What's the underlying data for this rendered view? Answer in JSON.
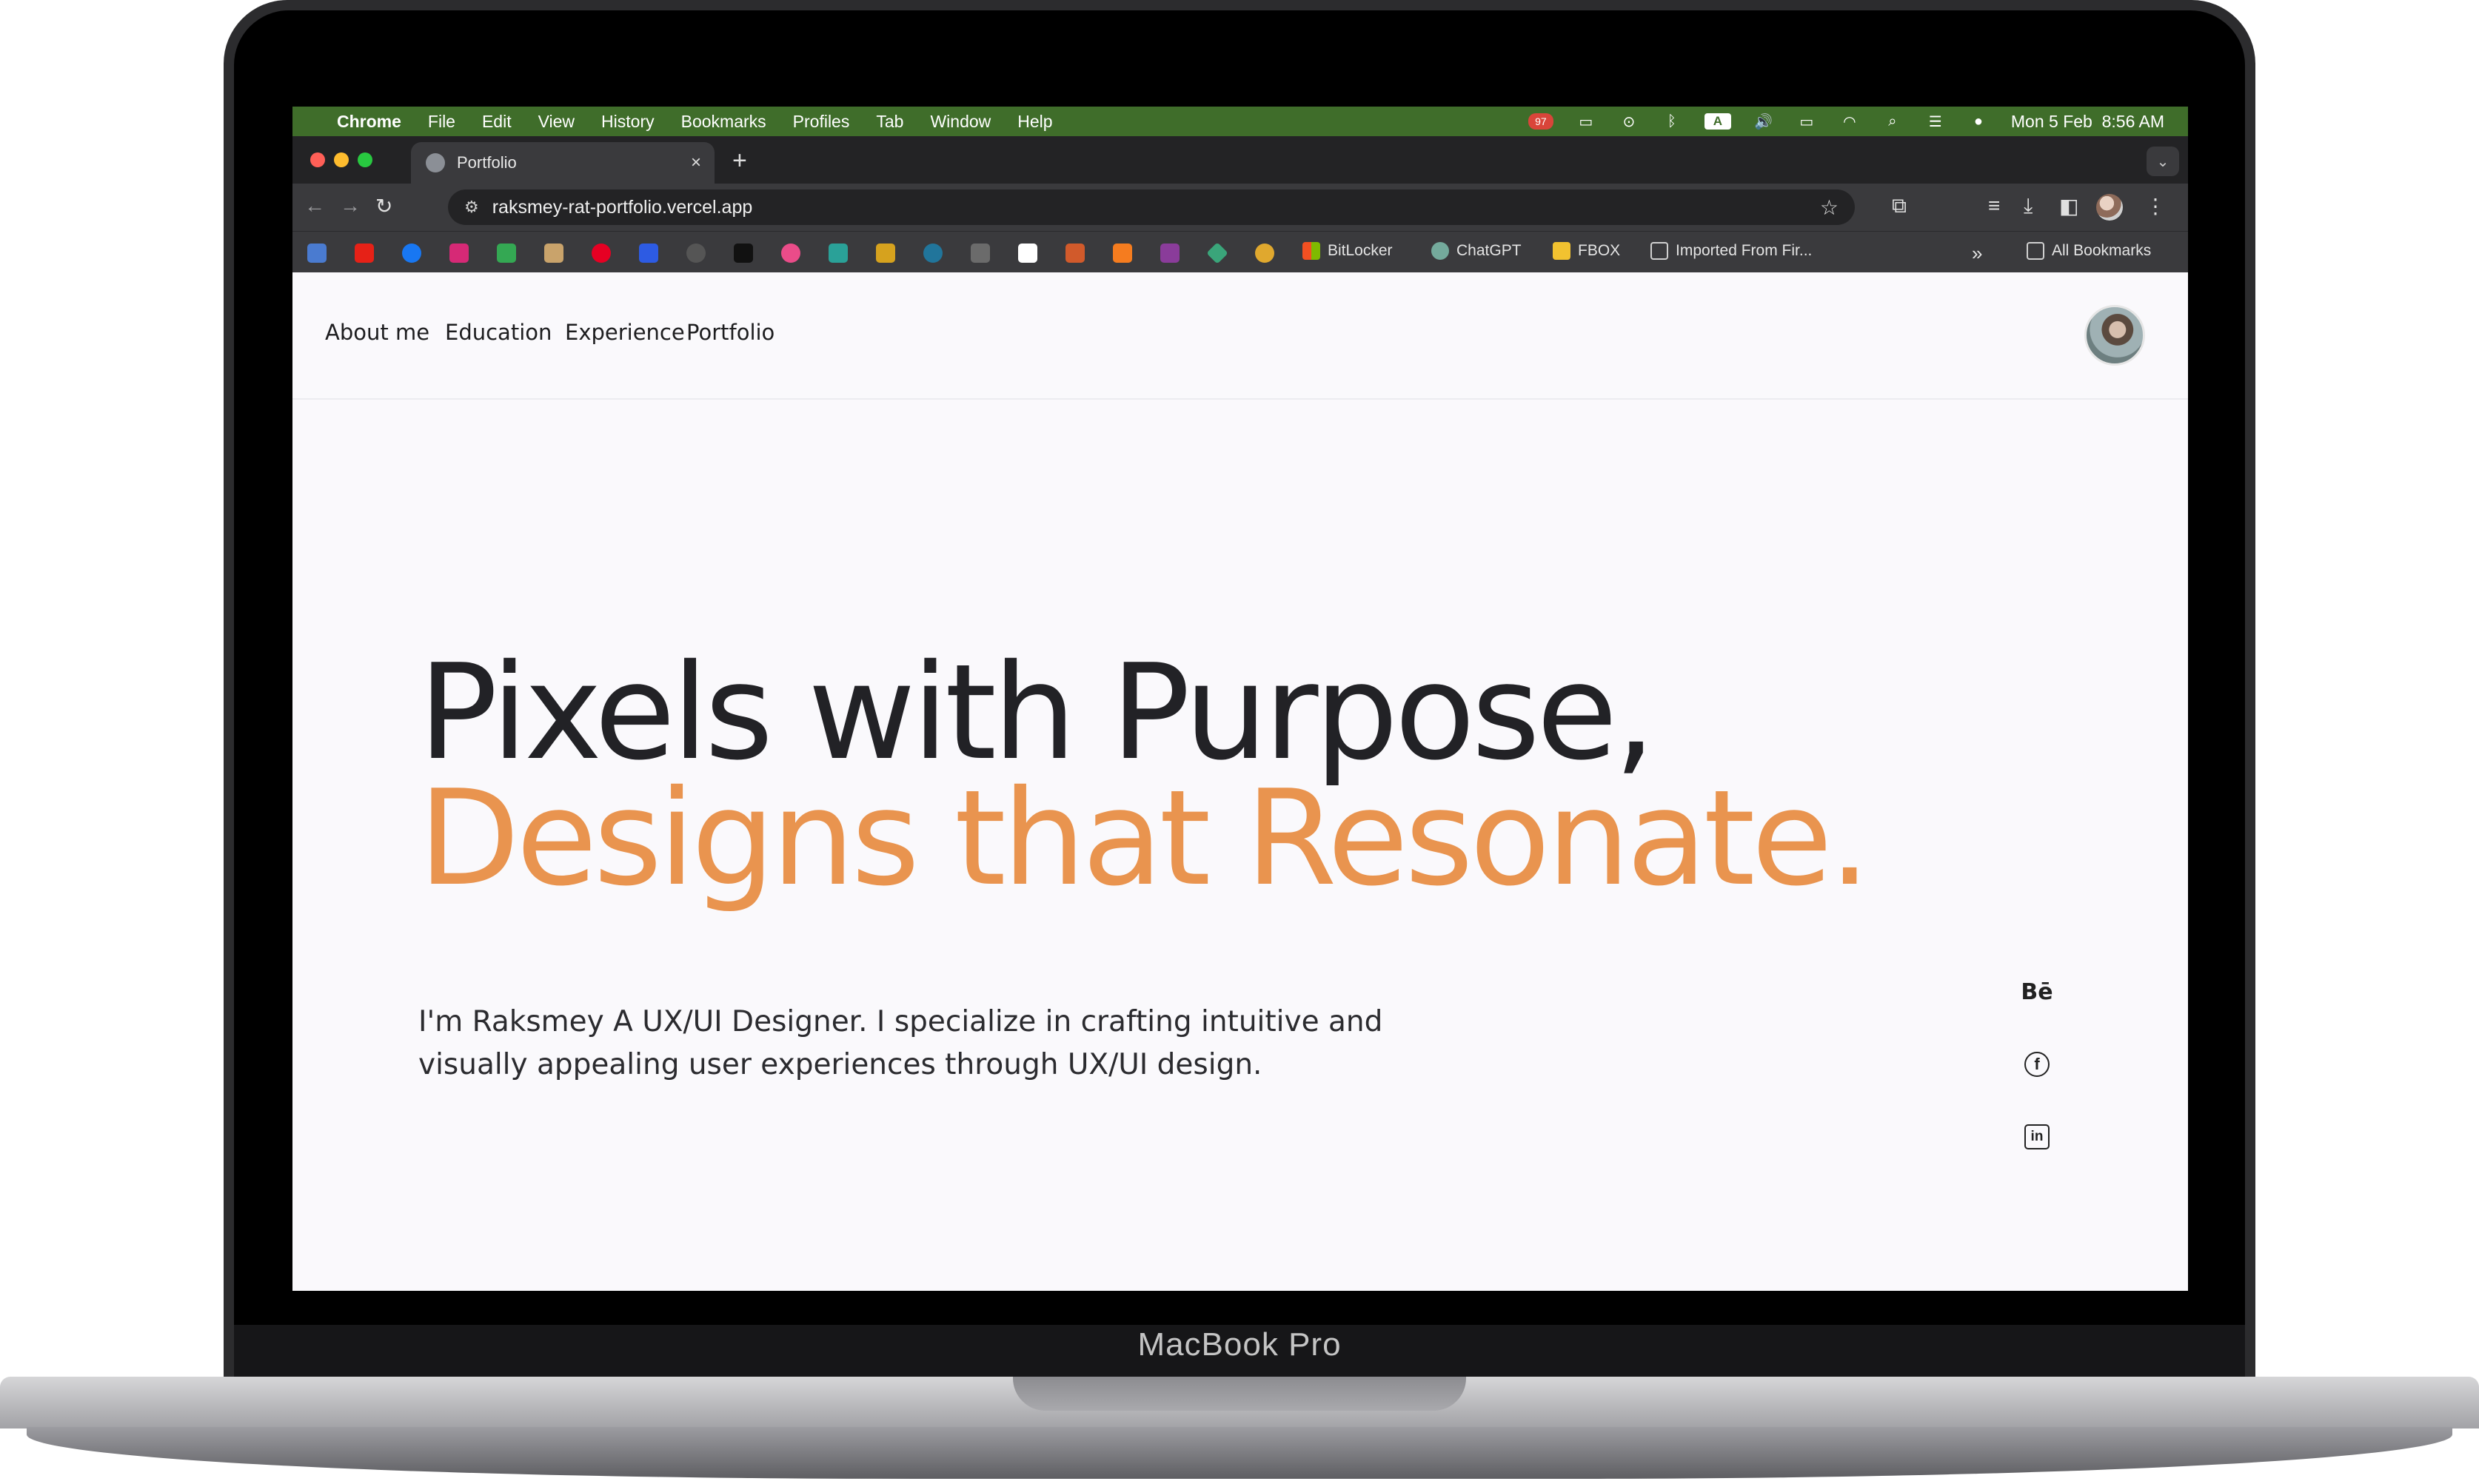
{
  "device": {
    "label": "MacBook Pro"
  },
  "menubar": {
    "app_name": "Chrome",
    "items": [
      "File",
      "Edit",
      "View",
      "History",
      "Bookmarks",
      "Profiles",
      "Tab",
      "Window",
      "Help"
    ],
    "badge_count": "97",
    "input_source": "A",
    "datetime": "Mon 5 Feb  8:56 AM"
  },
  "browser": {
    "tab_title": "Portfolio",
    "tab_close": "×",
    "new_tab": "+",
    "url": "raksmey-rat-portfolio.vercel.app",
    "bookmarks": {
      "named": [
        "BitLocker",
        "ChatGPT",
        "FBOX",
        "Imported From Fir..."
      ],
      "overflow": "»",
      "all_label": "All Bookmarks"
    }
  },
  "site": {
    "nav": [
      "About me",
      "Education",
      "Experience",
      "Portfolio"
    ],
    "headline_part1": "Pixels with Purpose, ",
    "headline_part2": "Designs that Resonate.",
    "intro": "I'm Raksmey A UX/UI Designer. I specialize in crafting intuitive and visually appealing user experiences through UX/UI design.",
    "social": {
      "behance": "Bē",
      "facebook": "f",
      "linkedin": "in"
    },
    "colors": {
      "accent": "#e9944f",
      "text": "#222226",
      "background": "#faf9fc"
    }
  },
  "colors": {
    "menubar": "#3f6d2a",
    "browser_chrome": "#3a3a3d"
  }
}
